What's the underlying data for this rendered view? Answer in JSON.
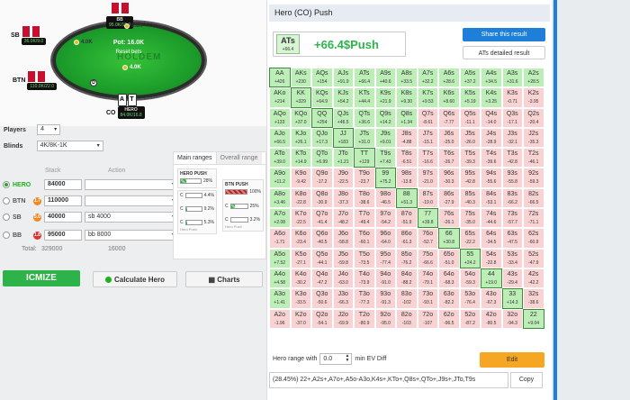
{
  "table": {
    "pot": "Pot: 16.0K",
    "reset": "Reset bets",
    "seats": {
      "bb": {
        "label": "BB",
        "stack": "95.0K/19.0"
      },
      "sb": {
        "label": "SB",
        "stack": "36.0K/9.0"
      },
      "btn": {
        "label": "BTN",
        "stack": "110.0K/22.0"
      },
      "co": {
        "label": "CO",
        "stack": "84.0K/16.8",
        "name": "HERO"
      }
    },
    "bets": {
      "bb": "8.0K",
      "sb": "4.0K",
      "btn": "4.0K"
    },
    "hero_cards": [
      "A",
      "T"
    ]
  },
  "form": {
    "players_label": "Players",
    "players_value": "4",
    "blinds_label": "Blinds",
    "blinds_value": "4K/8K-1K",
    "col_stack": "Stack",
    "col_action": "Action",
    "players": [
      {
        "pos": "HERO",
        "badge": "",
        "stack": "84000",
        "action": "",
        "active": true
      },
      {
        "pos": "BTN",
        "badge": "1.7",
        "stack": "110000",
        "action": "",
        "active": false
      },
      {
        "pos": "SB",
        "badge": "5.6",
        "stack": "40000",
        "action": "sb 4000",
        "active": false
      },
      {
        "pos": "BB",
        "badge": "1.8",
        "stack": "95000",
        "action": "bb 8000",
        "active": false
      }
    ],
    "total_label": "Total:",
    "total_stack": "329000",
    "total_action": "16000"
  },
  "buttons": {
    "icmize": "ICMIZE",
    "calc": "Calculate Hero",
    "charts": "Charts"
  },
  "ranges": {
    "tab_main": "Main ranges",
    "tab_overall": "Overall range",
    "hero_push": {
      "title": "HERO PUSH",
      "rows": [
        {
          "v": "28%",
          "pct": 28
        }
      ],
      "foot": "Hero Push"
    },
    "calls": [
      {
        "v": "4.4%",
        "pct": 4.4
      },
      {
        "v": "9.2%",
        "pct": 9.2
      },
      {
        "v": "5.3%",
        "pct": 5.3
      }
    ],
    "btn_push": {
      "title": "BTN PUSH",
      "rows": [
        {
          "v": "100%",
          "pct": 100,
          "red": true
        },
        {
          "v": "25%",
          "pct": 25
        },
        {
          "v": "3.2%",
          "pct": 3.2
        }
      ],
      "foot": "Hero Push"
    }
  },
  "panel": {
    "title": "Hero (CO) Push",
    "hand": {
      "name": "ATs",
      "ev": "+66.4",
      "result": "+66.4$Push"
    },
    "share": "Share this result",
    "detail": "ATs detailed result",
    "grid": [
      [
        [
          "AA",
          "+426"
        ],
        [
          "AKs",
          "+230"
        ],
        [
          "AQs",
          "+154"
        ],
        [
          "AJs",
          "+91.9"
        ],
        [
          "ATs",
          "+66.4"
        ],
        [
          "A9s",
          "+40.6"
        ],
        [
          "A8s",
          "+33.5"
        ],
        [
          "A7s",
          "+32.2"
        ],
        [
          "A6s",
          "+28.6"
        ],
        [
          "A5s",
          "+37.2"
        ],
        [
          "A4s",
          "+34.5"
        ],
        [
          "A3s",
          "+31.6"
        ],
        [
          "A2s",
          "+28.5"
        ]
      ],
      [
        [
          "AKo",
          "+214"
        ],
        [
          "KK",
          "+329"
        ],
        [
          "KQs",
          "+64.9"
        ],
        [
          "KJs",
          "+54.2"
        ],
        [
          "KTs",
          "+44.4"
        ],
        [
          "K9s",
          "+21.9"
        ],
        [
          "K8s",
          "+9.30"
        ],
        [
          "K7s",
          "+9.53"
        ],
        [
          "K6s",
          "+8.60"
        ],
        [
          "K5s",
          "+5.19"
        ],
        [
          "K4s",
          "+3.25"
        ],
        [
          "K3s",
          "-0.71"
        ],
        [
          "K2s",
          "-3.95"
        ]
      ],
      [
        [
          "AQo",
          "+133"
        ],
        [
          "KQo",
          "+37.0"
        ],
        [
          "QQ",
          "+254"
        ],
        [
          "QJs",
          "+46.5"
        ],
        [
          "QTs",
          "+36.6"
        ],
        [
          "Q9s",
          "+14.2"
        ],
        [
          "Q8s",
          "+1.34"
        ],
        [
          "Q7s",
          "-8.61"
        ],
        [
          "Q6s",
          "-7.77"
        ],
        [
          "Q5s",
          "-11.1"
        ],
        [
          "Q4s",
          "-14.0"
        ],
        [
          "Q3s",
          "-17.1"
        ],
        [
          "Q2s",
          "-20.4"
        ]
      ],
      [
        [
          "AJo",
          "+66.5"
        ],
        [
          "KJo",
          "+26.1"
        ],
        [
          "QJo",
          "+17.3"
        ],
        [
          "JJ",
          "+183"
        ],
        [
          "JTs",
          "+31.0"
        ],
        [
          "J9s",
          "+9.01"
        ],
        [
          "J8s",
          "-4.88"
        ],
        [
          "J7s",
          "-15.1"
        ],
        [
          "J6s",
          "-25.0"
        ],
        [
          "J5s",
          "-26.0"
        ],
        [
          "J4s",
          "-28.9"
        ],
        [
          "J3s",
          "-32.1"
        ],
        [
          "J2s",
          "-35.3"
        ]
      ],
      [
        [
          "ATo",
          "+39.0"
        ],
        [
          "KTo",
          "+14.9"
        ],
        [
          "QTo",
          "+6.99"
        ],
        [
          "JTo",
          "+1.21"
        ],
        [
          "TT",
          "+129"
        ],
        [
          "T9s",
          "+7.43"
        ],
        [
          "T8s",
          "-6.51"
        ],
        [
          "T7s",
          "-16.6"
        ],
        [
          "T6s",
          "-26.7"
        ],
        [
          "T5s",
          "-39.3"
        ],
        [
          "T4s",
          "-39.6"
        ],
        [
          "T3s",
          "-42.8"
        ],
        [
          "T2s",
          "-46.1"
        ]
      ],
      [
        [
          "A9o",
          "+11.2"
        ],
        [
          "K9o",
          "-9.42"
        ],
        [
          "Q9o",
          "-17.2"
        ],
        [
          "J9o",
          "-22.5"
        ],
        [
          "T9o",
          "-23.7"
        ],
        [
          "99",
          "+75.2"
        ],
        [
          "98s",
          "-13.8"
        ],
        [
          "97s",
          "-21.0"
        ],
        [
          "96s",
          "-30.3"
        ],
        [
          "95s",
          "-42.8"
        ],
        [
          "94s",
          "-55.6"
        ],
        [
          "93s",
          "-55.8"
        ],
        [
          "92s",
          "-59.3"
        ]
      ],
      [
        [
          "A8o",
          "+3.46"
        ],
        [
          "K8o",
          "-22.8"
        ],
        [
          "Q8o",
          "-30.9"
        ],
        [
          "J8o",
          "-37.3"
        ],
        [
          "T8o",
          "-38.6"
        ],
        [
          "98o",
          "-46.5"
        ],
        [
          "88",
          "+51.3"
        ],
        [
          "87s",
          "-19.0"
        ],
        [
          "86s",
          "-27.9"
        ],
        [
          "85s",
          "-40.3"
        ],
        [
          "84s",
          "-53.1"
        ],
        [
          "83s",
          "-66.2"
        ],
        [
          "82s",
          "-66.5"
        ]
      ],
      [
        [
          "A7o",
          "+2.08"
        ],
        [
          "K7o",
          "-22.5"
        ],
        [
          "Q7o",
          "-41.4"
        ],
        [
          "J7o",
          "-48.2"
        ],
        [
          "T7o",
          "-49.4"
        ],
        [
          "97o",
          "-54.2"
        ],
        [
          "87o",
          "-51.9"
        ],
        [
          "77",
          "+39.8"
        ],
        [
          "76s",
          "-26.1"
        ],
        [
          "75s",
          "-35.0"
        ],
        [
          "74s",
          "-44.6"
        ],
        [
          "73s",
          "-57.7"
        ],
        [
          "72s",
          "-71.1"
        ]
      ],
      [
        [
          "A6o",
          "-1.71"
        ],
        [
          "K6o",
          "-23.4"
        ],
        [
          "Q6o",
          "-40.5"
        ],
        [
          "J6o",
          "-58.8"
        ],
        [
          "T6o",
          "-60.1"
        ],
        [
          "96o",
          "-64.0"
        ],
        [
          "86o",
          "-61.3"
        ],
        [
          "76o",
          "-52.7"
        ],
        [
          "66",
          "+30.8"
        ],
        [
          "65s",
          "-22.2"
        ],
        [
          "64s",
          "-34.5"
        ],
        [
          "63s",
          "-47.5"
        ],
        [
          "62s",
          "-60.9"
        ]
      ],
      [
        [
          "A5o",
          "+7.52"
        ],
        [
          "K5o",
          "-27.1"
        ],
        [
          "Q5o",
          "-44.1"
        ],
        [
          "J5o",
          "-59.8"
        ],
        [
          "T5o",
          "-73.5"
        ],
        [
          "95o",
          "-77.4"
        ],
        [
          "85o",
          "-76.2"
        ],
        [
          "75o",
          "-66.6"
        ],
        [
          "65o",
          "-51.0"
        ],
        [
          "55",
          "+24.2"
        ],
        [
          "54s",
          "-22.8"
        ],
        [
          "53s",
          "-33.4"
        ],
        [
          "52s",
          "-47.9"
        ]
      ],
      [
        [
          "A4o",
          "+4.58"
        ],
        [
          "K4o",
          "-30.2"
        ],
        [
          "Q4o",
          "-47.2"
        ],
        [
          "J4o",
          "-63.0"
        ],
        [
          "T4o",
          "-73.9"
        ],
        [
          "94o",
          "-91.0"
        ],
        [
          "84o",
          "-88.2"
        ],
        [
          "74o",
          "-79.1"
        ],
        [
          "64o",
          "-68.3"
        ],
        [
          "54o",
          "-59.3"
        ],
        [
          "44",
          "+19.0"
        ],
        [
          "43s",
          "-29.4"
        ],
        [
          "42s",
          "-42.2"
        ]
      ],
      [
        [
          "A3o",
          "+1.41"
        ],
        [
          "K3o",
          "-33.5"
        ],
        [
          "Q3o",
          "-50.6"
        ],
        [
          "J3o",
          "-66.3"
        ],
        [
          "T3o",
          "-77.3"
        ],
        [
          "93o",
          "-91.3"
        ],
        [
          "83o",
          "-102"
        ],
        [
          "73o",
          "-93.1"
        ],
        [
          "63o",
          "-82.2"
        ],
        [
          "53o",
          "-76.4"
        ],
        [
          "43o",
          "-67.3"
        ],
        [
          "33",
          "+14.3"
        ],
        [
          "32s",
          "-38.6"
        ]
      ],
      [
        [
          "A2o",
          "-1.96"
        ],
        [
          "K2o",
          "-37.0"
        ],
        [
          "Q2o",
          "-54.1"
        ],
        [
          "J2o",
          "-69.9"
        ],
        [
          "T2o",
          "-80.9"
        ],
        [
          "92o",
          "-95.0"
        ],
        [
          "82o",
          "-103"
        ],
        [
          "72o",
          "-107"
        ],
        [
          "62o",
          "-96.5"
        ],
        [
          "52o",
          "-87.2"
        ],
        [
          "42o",
          "-80.5"
        ],
        [
          "32o",
          "-94.3"
        ],
        [
          "22",
          "+9.04"
        ]
      ]
    ],
    "range_label": "Hero range with",
    "range_value": "0.0",
    "range_suffix": "min EV Diff",
    "edit": "Edit",
    "range_text": "(28.45%) 22+,A2s+,A7o+,A5o-A3o,K4s+,KTo+,Q8s+,QTo+,J9s+,JTo,T9s",
    "copy": "Copy"
  }
}
